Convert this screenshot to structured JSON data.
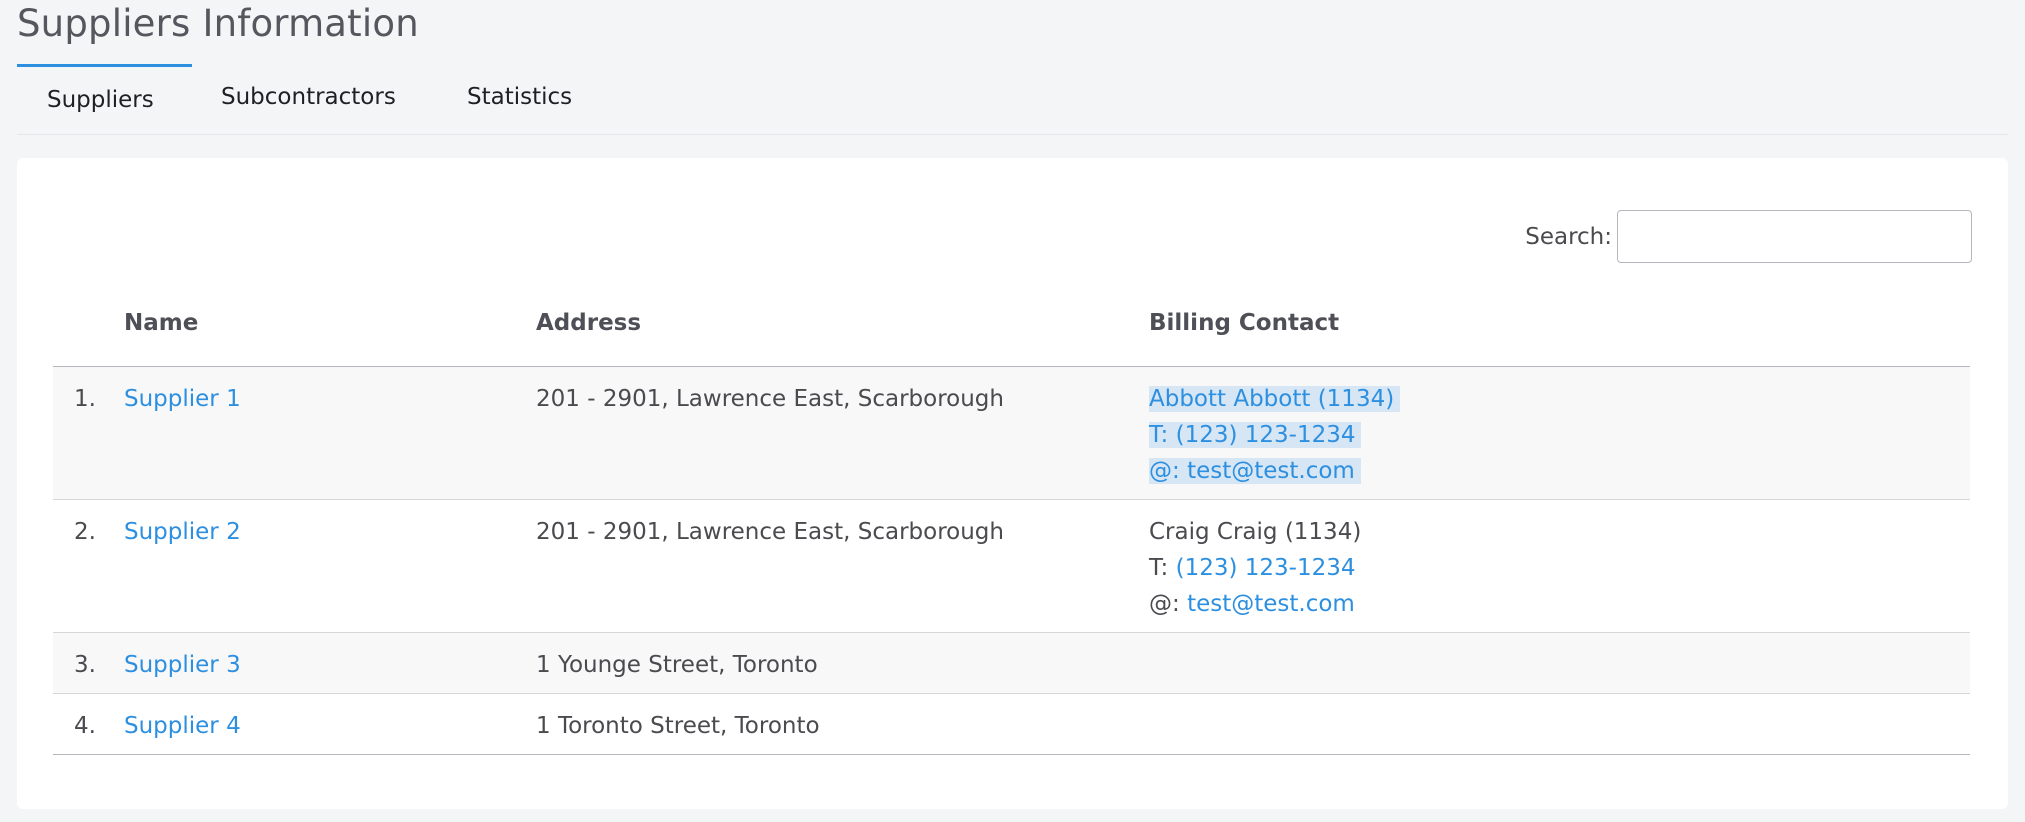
{
  "page": {
    "title": "Suppliers Information"
  },
  "tabs": [
    {
      "label": "Suppliers",
      "active": true
    },
    {
      "label": "Subcontractors",
      "active": false
    },
    {
      "label": "Statistics",
      "active": false
    }
  ],
  "search": {
    "label": "Search:",
    "value": "",
    "placeholder": ""
  },
  "table": {
    "columns": {
      "name": "Name",
      "address": "Address",
      "billing": "Billing Contact"
    },
    "rows": [
      {
        "index": "1.",
        "name": "Supplier 1",
        "address": "201 - 2901, Lawrence East, Scarborough",
        "contact_name": "Abbott Abbott (1134)",
        "phone_prefix": "T: ",
        "phone": "(123) 123-1234",
        "email_prefix": "@: ",
        "email": "test@test.com"
      },
      {
        "index": "2.",
        "name": "Supplier 2",
        "address": "201 - 2901, Lawrence East, Scarborough",
        "contact_name": "Craig Craig (1134)",
        "phone_prefix": "T: ",
        "phone": "(123) 123-1234",
        "email_prefix": "@: ",
        "email": "test@test.com"
      },
      {
        "index": "3.",
        "name": "Supplier 3",
        "address": "1 Younge Street, Toronto"
      },
      {
        "index": "4.",
        "name": "Supplier 4",
        "address": "1 Toronto Street, Toronto"
      }
    ]
  },
  "colors": {
    "accent": "#2d8fdf",
    "selection": "#d6e6f4",
    "background": "#f4f5f7",
    "card": "#ffffff"
  }
}
